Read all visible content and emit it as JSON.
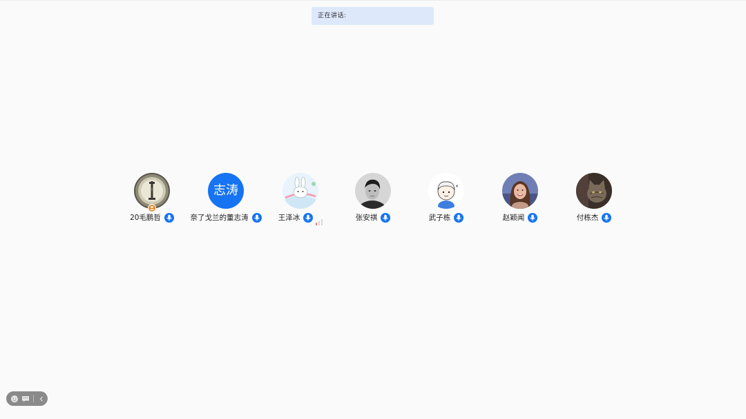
{
  "banner": {
    "speaking_label": "正在讲话:"
  },
  "participants": [
    {
      "name": "20毛鹏哲",
      "avatar": "photo-ring-tower",
      "host": true,
      "mic": "on"
    },
    {
      "name": "奈了戈兰的董志涛",
      "avatar_text": "志涛",
      "avatar_color": "#1673f2",
      "mic": "on"
    },
    {
      "name": "王泽冰",
      "avatar": "cartoon-rabbit",
      "mic": "on",
      "signal": "weak"
    },
    {
      "name": "张安祺",
      "avatar": "photo-bw-man",
      "mic": "on"
    },
    {
      "name": "武子栋",
      "avatar": "cartoon-boy",
      "mic": "on"
    },
    {
      "name": "赵颖闻",
      "avatar": "photo-woman",
      "mic": "on"
    },
    {
      "name": "付栋杰",
      "avatar": "photo-cat",
      "mic": "on"
    }
  ],
  "toolbar": {
    "icons": [
      "emoji-icon",
      "chat-icon",
      "collapse-chevron-icon"
    ]
  },
  "colors": {
    "accent": "#1673f2",
    "banner_bg": "#dde8fb",
    "host_badge": "#f08c2b",
    "toolbar_bg": "#8a8a8a"
  }
}
